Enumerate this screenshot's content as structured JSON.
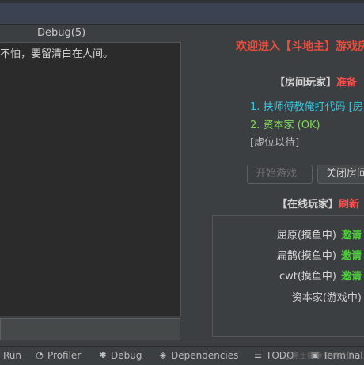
{
  "debug_tab": {
    "title": "Debug(5)"
  },
  "console": {
    "line": "不怕，要留清白在人间。"
  },
  "room": {
    "welcome": "欢迎进入【斗地主】游戏房",
    "players_label": "【房间玩家】",
    "players_status": "准备",
    "players": [
      "1. 扶师傅教俺打代码 [房",
      "2. 资本家 (OK)",
      "[虚位以待]"
    ],
    "start_button": "开始游戏",
    "close_button": "关闭房间"
  },
  "online": {
    "label": "【在线玩家】",
    "refresh": "刷新",
    "rows": [
      {
        "name": "屈原(摸鱼中)",
        "action": "邀请"
      },
      {
        "name": "扁鹊(摸鱼中)",
        "action": "邀请"
      },
      {
        "name": "cwt(摸鱼中)",
        "action": "邀请"
      },
      {
        "name": "资本家(游戏中)",
        "action": ""
      }
    ]
  },
  "statusbar": {
    "run": "Run",
    "profiler": "Profiler",
    "debug": "Debug",
    "dependencies": "Dependencies",
    "todo": "TODO",
    "terminal": "Terminal"
  },
  "watermark": "@稀土掘金技术社区",
  "colors": {
    "welcome": "#e74c3c",
    "player_ready": "#35c8e0",
    "player_ok": "#7fd858",
    "invite": "#4cd137",
    "tag_red": "#ff4d4d"
  }
}
